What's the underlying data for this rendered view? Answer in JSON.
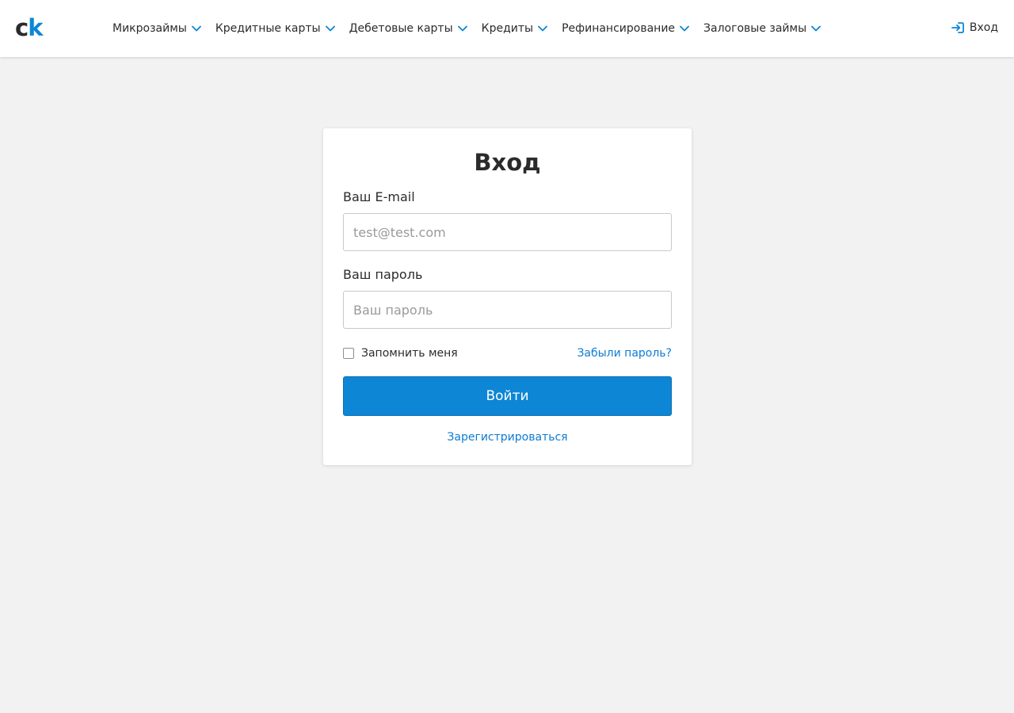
{
  "header": {
    "logo": {
      "c": "c",
      "k": "k"
    },
    "nav": [
      {
        "label": "Микрозаймы",
        "icon": "chevron-down-icon"
      },
      {
        "label": "Кредитные карты",
        "icon": "chevron-down-icon"
      },
      {
        "label": "Дебетовые карты",
        "icon": "chevron-down-icon"
      },
      {
        "label": "Кредиты",
        "icon": "chevron-down-icon"
      },
      {
        "label": "Рефинансирование",
        "icon": "chevron-down-icon"
      },
      {
        "label": "Залоговые займы",
        "icon": "chevron-down-icon"
      }
    ],
    "login_label": "Вход",
    "login_icon": "sign-in-icon"
  },
  "form": {
    "title": "Вход",
    "email_label": "Ваш E-mail",
    "email_placeholder": "test@test.com",
    "email_value": "",
    "password_label": "Ваш пароль",
    "password_placeholder": "Ваш пароль",
    "password_value": "",
    "remember_label": "Запомнить меня",
    "remember_checked": false,
    "forgot_label": "Забыли пароль?",
    "submit_label": "Войти",
    "register_label": "Зарегистрироваться"
  },
  "colors": {
    "accent": "#0d86d6",
    "link": "#0d7cd1",
    "background": "#f2f2f2",
    "text": "#2b2b2b"
  }
}
